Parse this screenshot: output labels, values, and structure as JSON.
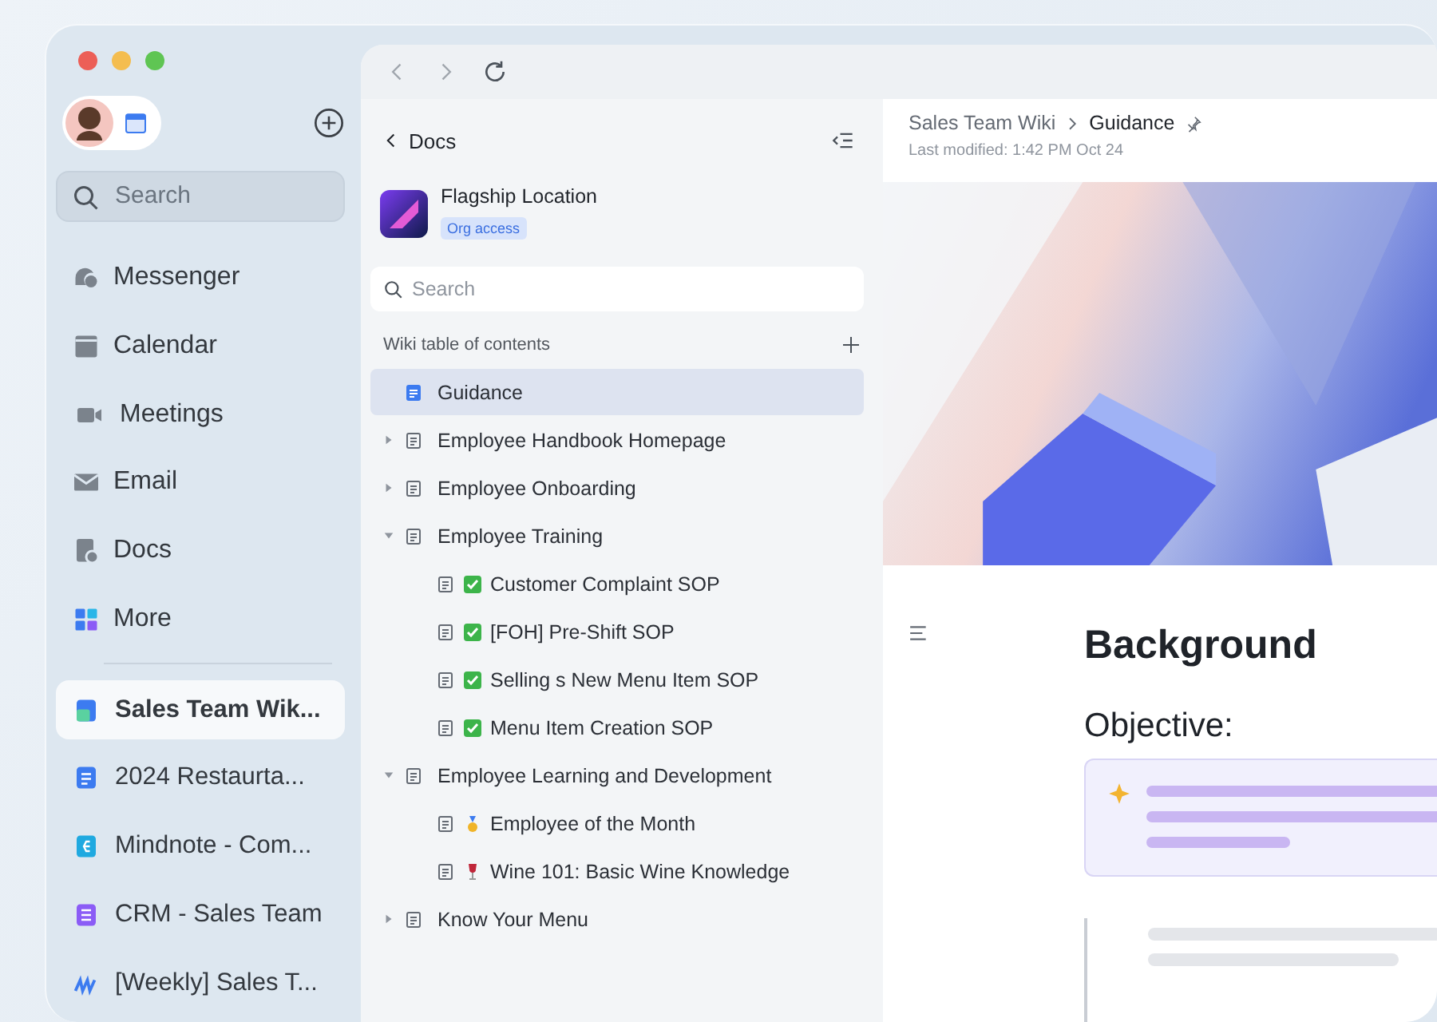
{
  "window": {
    "traffic_lights": [
      {
        "color": "#ec5f57"
      },
      {
        "color": "#f4bd4f"
      },
      {
        "color": "#5fc553"
      }
    ]
  },
  "sidebar": {
    "search": {
      "placeholder": "Search"
    },
    "nav": [
      {
        "label": "Messenger",
        "kind": "messenger"
      },
      {
        "label": "Calendar",
        "kind": "calendar"
      },
      {
        "label": "Meetings",
        "kind": "meetings"
      },
      {
        "label": "Email",
        "kind": "email"
      },
      {
        "label": "Docs",
        "kind": "docs"
      },
      {
        "label": "More",
        "kind": "more"
      }
    ],
    "docs": [
      {
        "label": "Sales Team Wik...",
        "kind": "wiki",
        "selected": true
      },
      {
        "label": "2024 Restaurta...",
        "kind": "doc",
        "selected": false
      },
      {
        "label": "Mindnote - Com...",
        "kind": "mindnote",
        "selected": false
      },
      {
        "label": "CRM - Sales Team",
        "kind": "sheet",
        "selected": false
      },
      {
        "label": "[Weekly] Sales T...",
        "kind": "board",
        "selected": false
      }
    ]
  },
  "docs_panel": {
    "back": "Docs",
    "space": {
      "title": "Flagship Location",
      "tag": "Org access"
    },
    "search": {
      "placeholder": "Search"
    },
    "toc_title": "Wiki table of contents",
    "tree": [
      {
        "label": "Guidance",
        "kind": "page",
        "selected": true
      },
      {
        "label": "Employee Handbook Homepage",
        "kind": "folder",
        "expanded": false,
        "selected": false
      },
      {
        "label": "Employee Onboarding",
        "kind": "folder",
        "expanded": false,
        "selected": false
      },
      {
        "label": "Employee Training",
        "kind": "folder",
        "expanded": true,
        "selected": false,
        "children": [
          {
            "label": "Customer Complaint SOP",
            "kind": "check",
            "selected": false
          },
          {
            "label": "[FOH] Pre-Shift SOP",
            "kind": "check",
            "selected": false
          },
          {
            "label": "Selling s New Menu Item SOP",
            "kind": "check",
            "selected": false
          },
          {
            "label": "Menu Item Creation SOP",
            "kind": "check",
            "selected": false
          }
        ]
      },
      {
        "label": "Employee Learning and Development",
        "kind": "folder",
        "expanded": true,
        "selected": false,
        "children": [
          {
            "label": "Employee of the Month",
            "kind": "medal",
            "selected": false
          },
          {
            "label": "Wine 101: Basic Wine Knowledge",
            "kind": "wine",
            "selected": false
          }
        ]
      },
      {
        "label": "Know Your Menu",
        "kind": "folder",
        "expanded": false,
        "selected": false
      }
    ]
  },
  "document": {
    "breadcrumb": [
      "Sales Team Wiki",
      "Guidance"
    ],
    "modified": "Last modified: 1:42 PM Oct 24",
    "cover": {
      "kind": "picture"
    },
    "heading": "Background",
    "subheading": "Objective:"
  }
}
